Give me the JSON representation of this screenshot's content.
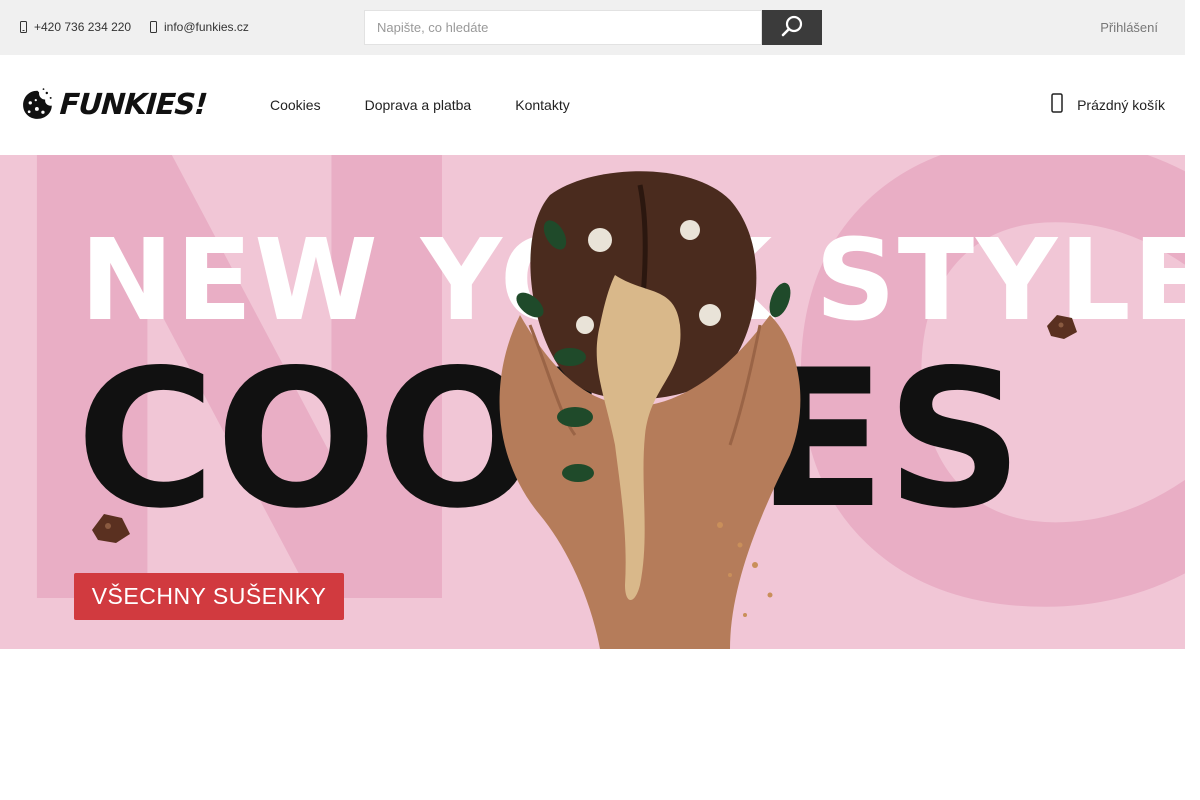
{
  "topbar": {
    "phone": "+420 736 234 220",
    "email": "info@funkies.cz",
    "phone_icon": "phone-icon",
    "email_icon": "mail-icon",
    "search_placeholder": "Napište, co hledáte",
    "search_icon": "search-icon",
    "login": "Přihlášení"
  },
  "header": {
    "logo_text": "FUNKIES!",
    "nav": [
      "Cookies",
      "Doprava a platba",
      "Kontakty"
    ],
    "cart_label": "Prázdný košík",
    "cart_icon": "cart-icon"
  },
  "banner": {
    "line1": "NEW YORK STYLE",
    "line2": "COOKIES",
    "cta": "VŠECHNY SUŠENKY",
    "background_letters": [
      "N",
      "C"
    ],
    "colors": {
      "background": "#f1c6d6",
      "cta": "#d13a3f"
    }
  }
}
